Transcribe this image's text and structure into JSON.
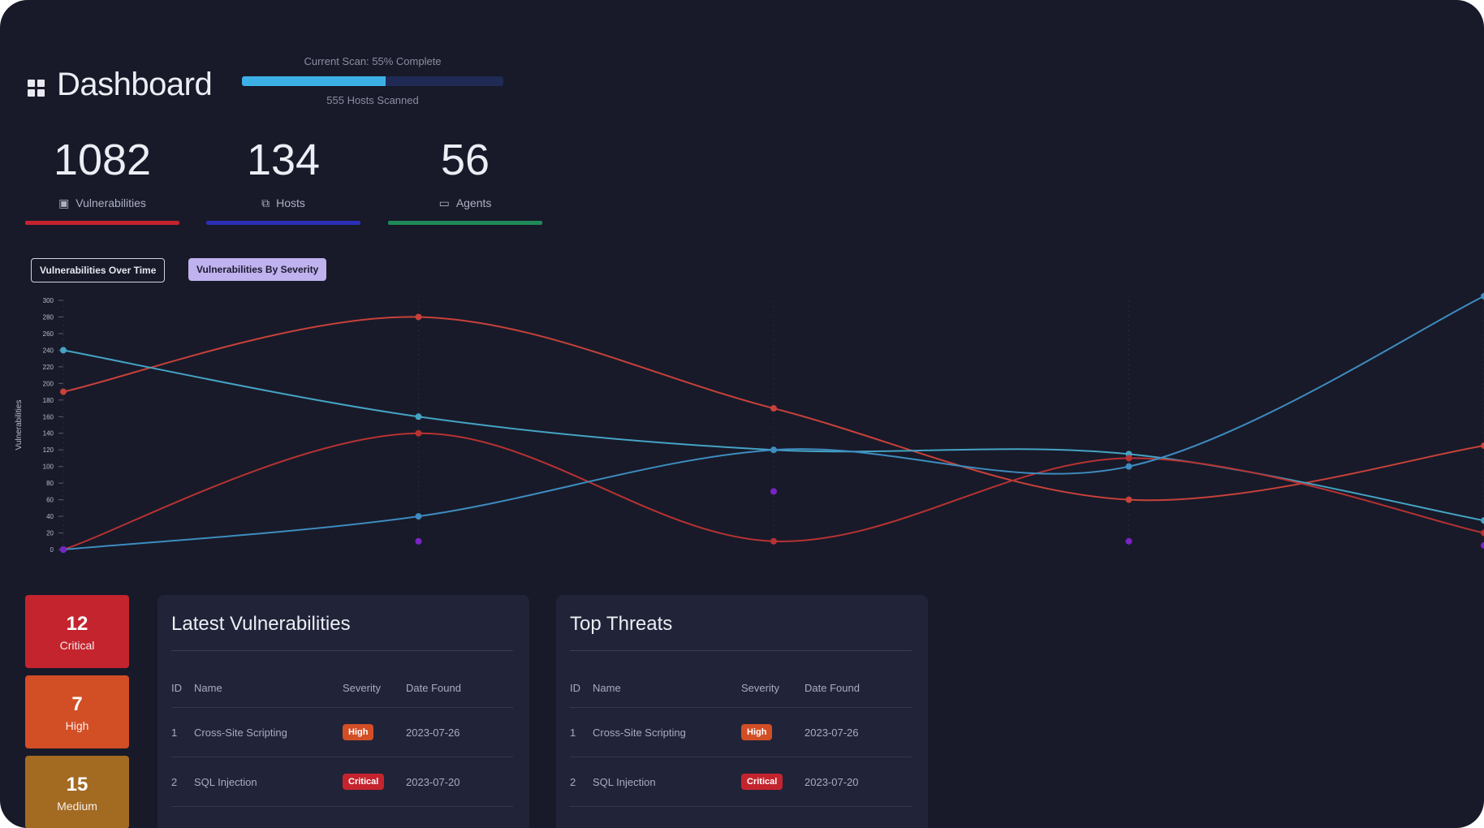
{
  "header": {
    "title": "Dashboard"
  },
  "scan": {
    "status": "Current Scan: 55% Complete",
    "hosts": "555 Hosts Scanned",
    "progress": 0.55
  },
  "stats": [
    {
      "value": "1082",
      "label": "Vulnerabilities",
      "color": "#c4242e"
    },
    {
      "value": "134",
      "label": "Hosts",
      "color": "#2b2fb8"
    },
    {
      "value": "56",
      "label": "Agents",
      "color": "#1f8a58"
    }
  ],
  "tabs": {
    "over_time": "Vulnerabilities Over Time",
    "by_severity": "Vulnerabilities By Severity"
  },
  "chart_data": {
    "type": "line",
    "ylabel": "Vulnerabilities",
    "ylim": [
      0,
      300
    ],
    "yticks": [
      0,
      20,
      40,
      60,
      80,
      100,
      120,
      140,
      160,
      180,
      200,
      220,
      240,
      260,
      280,
      300
    ],
    "x": [
      0,
      1,
      2,
      3,
      4
    ],
    "grid": true,
    "series": [
      {
        "color": "#c8413a",
        "values": [
          190,
          280,
          170,
          60,
          125
        ]
      },
      {
        "color": "#45a3c4",
        "values": [
          240,
          160,
          120,
          115,
          35
        ]
      },
      {
        "color": "#b83232",
        "values": [
          0,
          140,
          10,
          110,
          20
        ]
      },
      {
        "color": "#3e8cc0",
        "values": [
          0,
          40,
          120,
          100,
          305
        ]
      },
      {
        "color": "#7a24c4",
        "values": [
          0,
          10,
          70,
          10,
          5
        ]
      }
    ]
  },
  "severity": [
    {
      "count": "12",
      "label": "Critical",
      "color": "#c4242e"
    },
    {
      "count": "7",
      "label": "High",
      "color": "#d24e25"
    },
    {
      "count": "15",
      "label": "Medium",
      "color": "#a36a22"
    }
  ],
  "latest": {
    "title": "Latest Vulnerabilities",
    "columns": [
      "ID",
      "Name",
      "Severity",
      "Date Found"
    ],
    "rows": [
      {
        "id": "1",
        "name": "Cross-Site Scripting",
        "severity": "High",
        "date": "2023-07-26",
        "color": "#d24e25"
      },
      {
        "id": "2",
        "name": "SQL Injection",
        "severity": "Critical",
        "date": "2023-07-20",
        "color": "#c4242e"
      }
    ]
  },
  "threats": {
    "title": "Top Threats",
    "columns": [
      "ID",
      "Name",
      "Severity",
      "Date Found"
    ],
    "rows": [
      {
        "id": "1",
        "name": "Cross-Site Scripting",
        "severity": "High",
        "date": "2023-07-26",
        "color": "#d24e25"
      },
      {
        "id": "2",
        "name": "SQL Injection",
        "severity": "Critical",
        "date": "2023-07-20",
        "color": "#c4242e"
      }
    ]
  }
}
